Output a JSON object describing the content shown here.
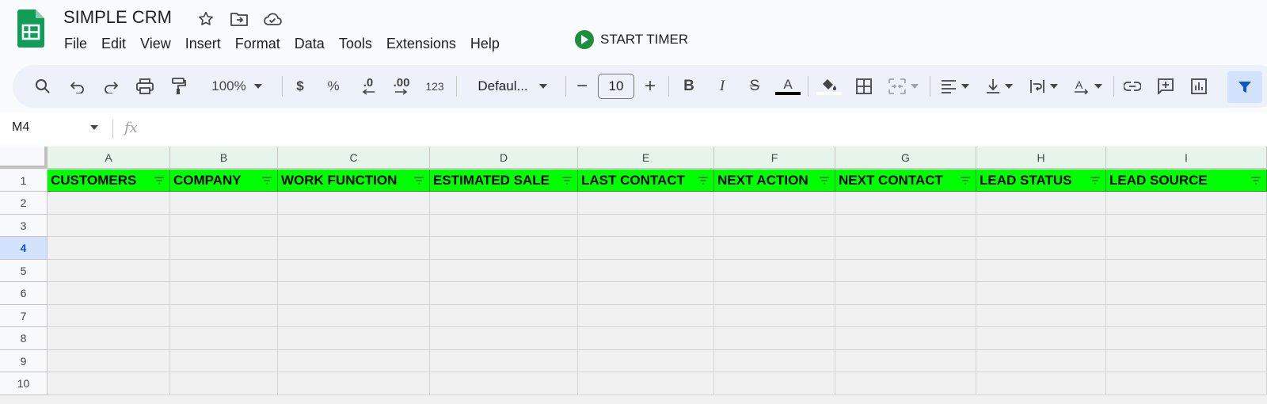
{
  "app": {
    "doc_title": "SIMPLE CRM",
    "timer_label": "START TIMER",
    "icons": [
      "sheets-logo-icon",
      "star-icon",
      "move-to-folder-icon",
      "cloud-saved-icon"
    ]
  },
  "menu": [
    "File",
    "Edit",
    "View",
    "Insert",
    "Format",
    "Data",
    "Tools",
    "Extensions",
    "Help"
  ],
  "toolbar": {
    "zoom": "100%",
    "currency": "$",
    "percent": "%",
    "decrease_decimal": ".0",
    "increase_decimal": ".00",
    "number_format": "123",
    "font": "Defaul...",
    "font_size": "10",
    "minus": "−",
    "plus": "+",
    "bold": "B",
    "italic": "I",
    "strike": "S",
    "text_color_label": "A",
    "colors": {
      "text_color_bar": "#000000",
      "fill_color_bar": "#ffffff",
      "header_fill": "#00ff00"
    }
  },
  "formula_bar": {
    "name_box": "M4",
    "fx": "fx",
    "formula": ""
  },
  "sheet": {
    "columns": [
      "A",
      "B",
      "C",
      "D",
      "E",
      "F",
      "G",
      "H",
      "I"
    ],
    "rows": [
      "1",
      "2",
      "3",
      "4",
      "5",
      "6",
      "7",
      "8",
      "9",
      "10"
    ],
    "selected_row": "4",
    "header_row": [
      "CUSTOMERS",
      "COMPANY",
      "WORK FUNCTION",
      "ESTIMATED SALE",
      "LAST CONTACT",
      "NEXT ACTION",
      "NEXT CONTACT",
      "LEAD STATUS",
      "LEAD SOURCE"
    ]
  }
}
